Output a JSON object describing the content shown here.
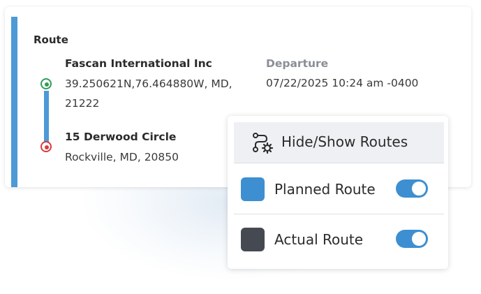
{
  "route": {
    "title": "Route",
    "accent_color": "#4d9ad6",
    "origin": {
      "name": "Fascan International Inc",
      "address_line1": "39.250621N,76.464880W, MD,",
      "address_line2": "21222",
      "marker_color": "#2f9e55"
    },
    "destination": {
      "name": "15 Derwood Circle",
      "address": "Rockville, MD, 20850",
      "marker_color": "#d83a3e"
    },
    "departure": {
      "label": "Departure",
      "value": "07/22/2025 10:24 am -0400"
    }
  },
  "routes_panel": {
    "title": "Hide/Show Routes",
    "icon": "route-settings-icon",
    "items": [
      {
        "label": "Planned Route",
        "color": "#3d8fd1",
        "enabled": true
      },
      {
        "label": "Actual Route",
        "color": "#454a52",
        "enabled": true
      }
    ],
    "toggle_on_color": "#3d8fd1"
  }
}
